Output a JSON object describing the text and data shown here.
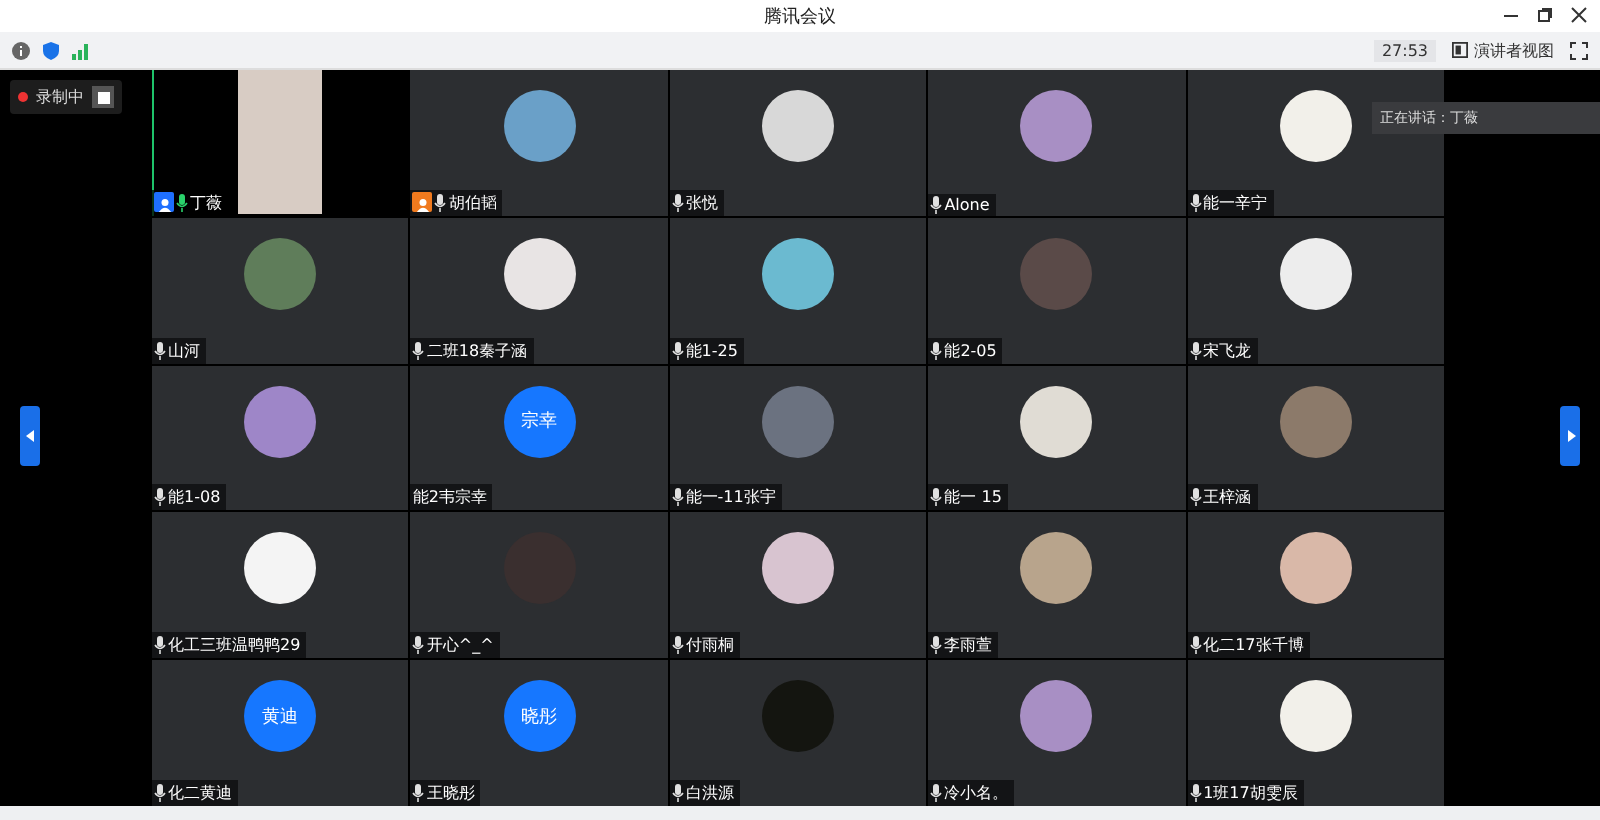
{
  "window": {
    "title": "腾讯会议"
  },
  "toolbar": {
    "time": "27:53",
    "view_button": "演讲者视图"
  },
  "recording": {
    "label": "录制中"
  },
  "speaking_popup": {
    "text": "正在讲话：丁薇"
  },
  "participants": [
    {
      "name": "丁薇",
      "kind": "video",
      "speaking": true,
      "mic": true,
      "color": "#1e6fff"
    },
    {
      "name": "胡伯韬",
      "kind": "photo",
      "speaking": false,
      "mic": true,
      "color": "#f07a1e"
    },
    {
      "name": "张悦",
      "kind": "photo",
      "speaking": false,
      "mic": true
    },
    {
      "name": "Alone",
      "kind": "photo",
      "speaking": false,
      "mic": true
    },
    {
      "name": "能一辛宁",
      "kind": "photo",
      "speaking": false,
      "mic": true
    },
    {
      "name": "山河",
      "kind": "photo",
      "speaking": false,
      "mic": true
    },
    {
      "name": "二班18秦子涵",
      "kind": "photo",
      "speaking": false,
      "mic": true
    },
    {
      "name": "能1-25",
      "kind": "photo",
      "speaking": false,
      "mic": true
    },
    {
      "name": "能2-05",
      "kind": "photo",
      "speaking": false,
      "mic": true
    },
    {
      "name": "宋飞龙",
      "kind": "photo",
      "speaking": false,
      "mic": true
    },
    {
      "name": "能1-08",
      "kind": "photo",
      "speaking": false,
      "mic": true
    },
    {
      "name": "能2韦宗幸",
      "kind": "initials",
      "initials": "宗幸",
      "speaking": false,
      "mic": false
    },
    {
      "name": "能一-11张宇",
      "kind": "photo",
      "speaking": false,
      "mic": true
    },
    {
      "name": "能一 15",
      "kind": "photo",
      "speaking": false,
      "mic": true
    },
    {
      "name": "王梓涵",
      "kind": "photo",
      "speaking": false,
      "mic": true
    },
    {
      "name": "化工三班温鸭鸭29",
      "kind": "photo",
      "speaking": false,
      "mic": true
    },
    {
      "name": "开心^_^",
      "kind": "photo",
      "speaking": false,
      "mic": true
    },
    {
      "name": "付雨桐",
      "kind": "photo",
      "speaking": false,
      "mic": true
    },
    {
      "name": "李雨萱",
      "kind": "photo",
      "speaking": false,
      "mic": true
    },
    {
      "name": "化二17张千博",
      "kind": "photo",
      "speaking": false,
      "mic": true
    },
    {
      "name": "化二黄迪",
      "kind": "initials",
      "initials": "黄迪",
      "speaking": false,
      "mic": true
    },
    {
      "name": "王晓彤",
      "kind": "initials",
      "initials": "晓彤",
      "speaking": false,
      "mic": true
    },
    {
      "name": "白洪源",
      "kind": "dark",
      "speaking": false,
      "mic": true
    },
    {
      "name": "冷小名。",
      "kind": "photo",
      "speaking": false,
      "mic": true
    },
    {
      "name": "1班17胡雯辰",
      "kind": "photo",
      "speaking": false,
      "mic": true
    }
  ]
}
